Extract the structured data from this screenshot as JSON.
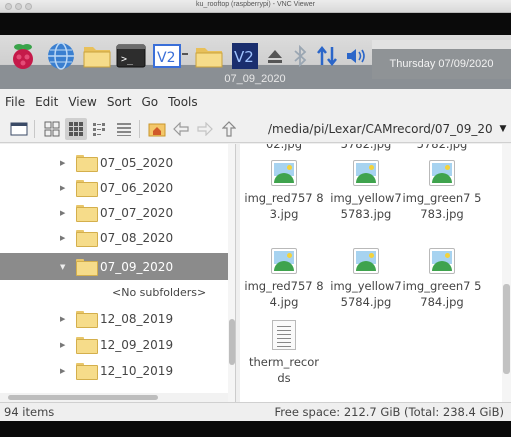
{
  "vnc": {
    "title": "ku_rooftop (raspberrypi) - VNC Viewer"
  },
  "panel": {
    "window_title": "07_09_2020",
    "clock_tooltip": "Thursday 07/09/2020",
    "icons": [
      "raspberry-pi-menu-icon",
      "web-browser-icon",
      "file-manager-icon",
      "terminal-icon",
      "vnc-server-icon",
      "eject-icon",
      "bluetooth-icon",
      "network-icon",
      "volume-icon"
    ]
  },
  "menubar": {
    "items": [
      "File",
      "Edit",
      "View",
      "Sort",
      "Go",
      "Tools"
    ]
  },
  "toolbar": {
    "path": "/media/pi/Lexar/CAMrecord/07_09_20"
  },
  "tree": {
    "rows": [
      {
        "label": "07_05_2020"
      },
      {
        "label": "07_06_2020"
      },
      {
        "label": "07_07_2020"
      },
      {
        "label": "07_08_2020"
      },
      {
        "label": "07_09_2020"
      },
      {
        "label": "12_08_2019"
      },
      {
        "label": "12_09_2019"
      },
      {
        "label": "12_10_2019"
      }
    ],
    "no_subfolders": "<No subfolders>"
  },
  "files": [
    {
      "name": "img_red757 83.jpg"
    },
    {
      "name": "img_yellow7 5783.jpg"
    },
    {
      "name": "img_green7 5783.jpg"
    },
    {
      "name": "img_red757 84.jpg"
    },
    {
      "name": "img_yellow7 5784.jpg"
    },
    {
      "name": "img_green7 5784.jpg"
    },
    {
      "name": "therm_recor ds"
    }
  ],
  "partial_top_names": [
    "02.jpg",
    "5782.jpg",
    "5782.jpg"
  ],
  "status": {
    "items": "94 items",
    "free_space": "Free space: 212.7 GiB (Total: 238.4 GiB)"
  },
  "colors": {
    "selection": "#8b8b8b",
    "panel_dark": "#8a8f94",
    "folder": "#f6dc8a"
  }
}
